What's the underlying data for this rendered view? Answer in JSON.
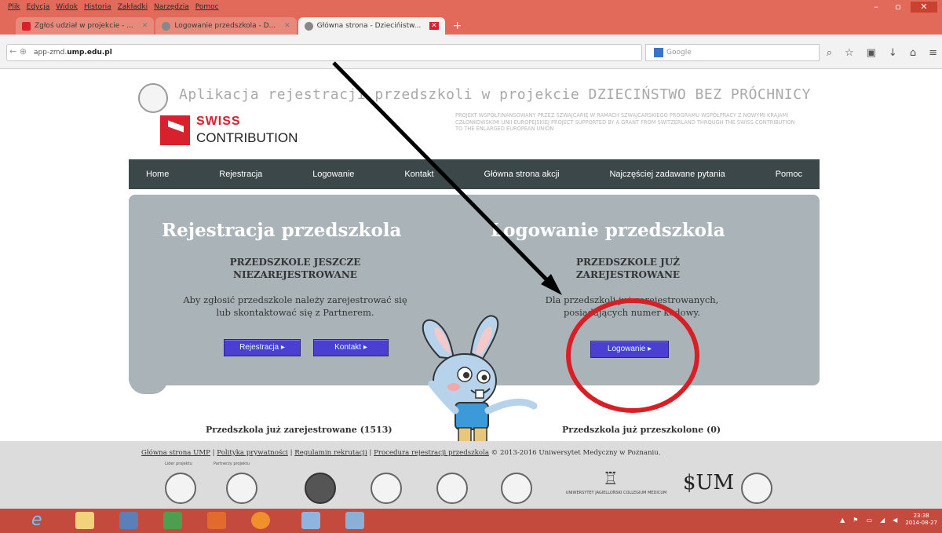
{
  "browser": {
    "menu": [
      "Plik",
      "Edycja",
      "Widok",
      "Historia",
      "Zakładki",
      "Narzędzia",
      "Pomoc"
    ],
    "tabs": [
      {
        "title": "Zgłoś udział w projekcie - ...",
        "fav_color": "#d9202d",
        "active": false
      },
      {
        "title": "Logowanie przedszkola - D...",
        "fav_color": "#888888",
        "active": false
      },
      {
        "title": "Główna strona - Dziecińistw...",
        "fav_color": "#888888",
        "active": true
      }
    ],
    "url_prefix": "app-zmd.",
    "url_bold": "ump.edu.pl",
    "search_placeholder": "Google",
    "window_buttons": [
      "–",
      "▫",
      "✕"
    ]
  },
  "header": {
    "app_title": "Aplikacja rejestracji przedszkoli w projekcie DZIECIŃSTWO BEZ PRÓCHNICY",
    "brand_line1": "SWISS",
    "brand_line2": "CONTRIBUTION",
    "description": "PROJEKT WSPÓŁFINANSOWANY PRZEZ SZWAJCARIĘ W RAMACH SZWAJCARSKIEGO PROGRAMU WSPÓŁPRACY Z NOWYMI KRAJAMI CZŁONKOWSKIMI UNII EUROPEJSKIEJ PROJECT SUPPORTED BY A GRANT FROM SWITZERLAND THROUGH THE SWISS CONTRIBUTION TO THE ENLARGED EUROPEAN UNION"
  },
  "nav": [
    "Home",
    "Rejestracja",
    "Logowanie",
    "Kontakt",
    "Główna strona akcji",
    "Najczęściej zadawane pytania",
    "Pomoc"
  ],
  "register": {
    "heading": "Rejestracja przedszkola",
    "sub1": "PRZEDSZKOLE JESZCZE",
    "sub2": "NIEZAREJESTROWANE",
    "text1": "Aby zgłosić przedszkole należy zarejestrować się",
    "text2": "lub skontaktować się z Partnerem.",
    "btn_register": "Rejestracja ▸",
    "btn_contact": "Kontakt ▸"
  },
  "login": {
    "heading": "Logowanie przedszkola",
    "sub1": "PRZEDSZKOLE JUŻ",
    "sub2": "ZAREJESTROWANE",
    "text1": "Dla przedszkoli już zarejestrowanych,",
    "text2": "posiadających numer kodowy.",
    "btn_login": "Logowanie ▸"
  },
  "stats": {
    "registered": "Przedszkola już zarejestrowane (1513)",
    "trained": "Przedszkola już przeszkolone (0)"
  },
  "footer": {
    "link1": "Główna strona UMP",
    "link2": "Polityka prywatności",
    "link3": "Regulamin rekrutacji",
    "link4": "Procedura rejestracji przedszkola",
    "copyright": "© 2013-2016 Uniwersytet Medyczny w Poznaniu.",
    "caption_leader": "Lider projektu",
    "caption_partner": "Partnerzy projektu",
    "uj_caption": "UNIWERSYTET JAGIELLOŃSKI COLLEGIUM MEDICUM",
    "sum_logo": "$UM"
  },
  "taskbar": {
    "time": "23:38",
    "date": "2014-08-27"
  },
  "colors": {
    "titlebar": "#e26a5a",
    "nav_bg": "#3b4748",
    "panel_bg": "#aab4b8",
    "button_bg": "#4a3fd0",
    "annotation": "#d81f26"
  }
}
